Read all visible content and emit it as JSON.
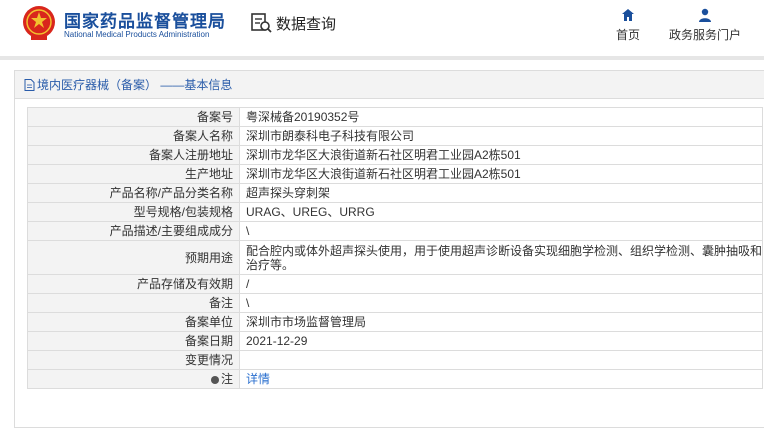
{
  "header": {
    "brand_cn": "国家药品监督管理局",
    "brand_en": "National Medical Products Administration",
    "data_query": "数据查询",
    "nav": [
      {
        "label": "首页",
        "icon": "home-icon"
      },
      {
        "label": "政务服务门户",
        "icon": "user-icon"
      }
    ]
  },
  "panel": {
    "title": "境内医疗器械（备案） ——基本信息"
  },
  "rows": [
    {
      "label": "备案号",
      "value": "粤深械备20190352号"
    },
    {
      "label": "备案人名称",
      "value": "深圳市朗泰科电子科技有限公司"
    },
    {
      "label": "备案人注册地址",
      "value": "深圳市龙华区大浪街道新石社区明君工业园A2栋501"
    },
    {
      "label": "生产地址",
      "value": "深圳市龙华区大浪街道新石社区明君工业园A2栋501"
    },
    {
      "label": "产品名称/产品分类名称",
      "value": "超声探头穿刺架"
    },
    {
      "label": "型号规格/包装规格",
      "value": "URAG、UREG、URRG"
    },
    {
      "label": "产品描述/主要组成成分",
      "value": "\\"
    },
    {
      "label": "预期用途",
      "value": "配合腔内或体外超声探头使用，用于使用超声诊断设备实现细胞学检测、组织学检测、囊肿抽吸和治疗等。"
    },
    {
      "label": "产品存储及有效期",
      "value": "/"
    },
    {
      "label": "备注",
      "value": "\\"
    },
    {
      "label": "备案单位",
      "value": "深圳市市场监督管理局"
    },
    {
      "label": "备案日期",
      "value": "2021-12-29"
    },
    {
      "label": "变更情况",
      "value": ""
    },
    {
      "label": "注",
      "value": "详情"
    }
  ],
  "colors": {
    "brand": "#1a4f9c",
    "link": "#2a6fcf",
    "label_bg": "#f3f3f3",
    "border": "#dcdcdc"
  }
}
